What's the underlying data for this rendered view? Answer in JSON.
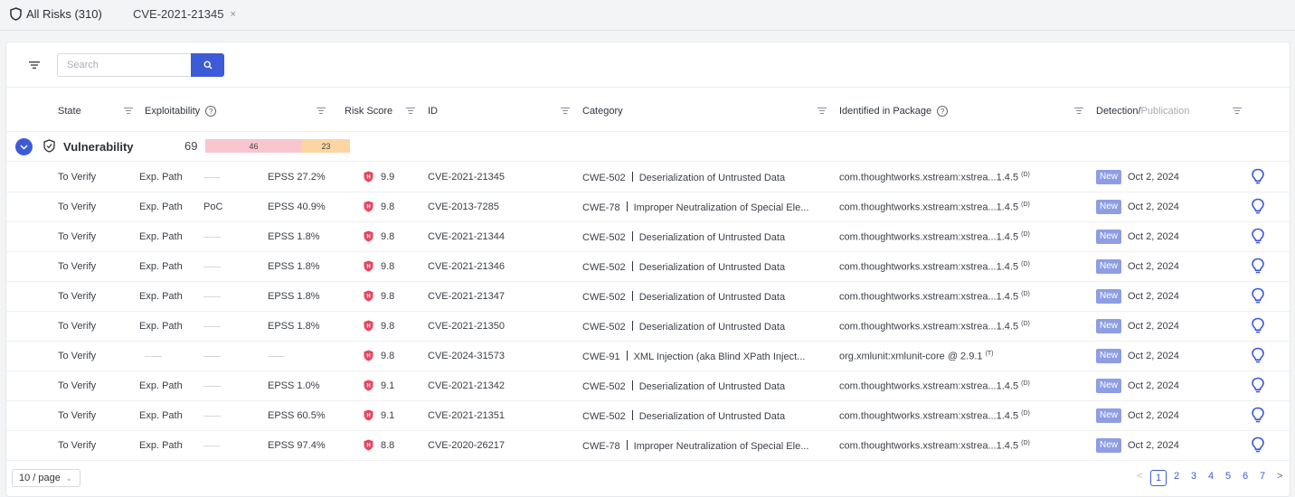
{
  "tabs": [
    {
      "label": "All Risks (310)",
      "icon": "shield-icon"
    },
    {
      "label": "CVE-2021-21345",
      "close": "×"
    }
  ],
  "search": {
    "placeholder": "Search"
  },
  "columns": {
    "state": "State",
    "exploitability": "Exploitability",
    "risk_score": "Risk Score",
    "id": "ID",
    "category": "Category",
    "package": "Identified in Package",
    "detection": "Detection",
    "detection_sep": "/",
    "publication": "Publication"
  },
  "group": {
    "label": "Vulnerability",
    "count": "69",
    "segments": [
      {
        "value": "46",
        "color": "#f8c6cf"
      },
      {
        "value": "23",
        "color": "#fbd6a3"
      }
    ]
  },
  "rows": [
    {
      "state": "To Verify",
      "exp": "Exp. Path",
      "poc": "",
      "epss": "EPSS 27.2%",
      "score": "9.9",
      "id": "CVE-2021-21345",
      "cwe": "CWE-502",
      "cat": "Deserialization of Untrusted Data",
      "pkg": "com.thoughtworks.xstream:xstrea...1.4.5",
      "pkg_tag": "(D)",
      "badge": "New",
      "date": "Oct 2, 2024"
    },
    {
      "state": "To Verify",
      "exp": "Exp. Path",
      "poc": "PoC",
      "epss": "EPSS 40.9%",
      "score": "9.8",
      "id": "CVE-2013-7285",
      "cwe": "CWE-78",
      "cat": "Improper Neutralization of Special Ele...",
      "pkg": "com.thoughtworks.xstream:xstrea...1.4.5",
      "pkg_tag": "(D)",
      "badge": "New",
      "date": "Oct 2, 2024"
    },
    {
      "state": "To Verify",
      "exp": "Exp. Path",
      "poc": "",
      "epss": "EPSS 1.8%",
      "score": "9.8",
      "id": "CVE-2021-21344",
      "cwe": "CWE-502",
      "cat": "Deserialization of Untrusted Data",
      "pkg": "com.thoughtworks.xstream:xstrea...1.4.5",
      "pkg_tag": "(D)",
      "badge": "New",
      "date": "Oct 2, 2024"
    },
    {
      "state": "To Verify",
      "exp": "Exp. Path",
      "poc": "",
      "epss": "EPSS 1.8%",
      "score": "9.8",
      "id": "CVE-2021-21346",
      "cwe": "CWE-502",
      "cat": "Deserialization of Untrusted Data",
      "pkg": "com.thoughtworks.xstream:xstrea...1.4.5",
      "pkg_tag": "(D)",
      "badge": "New",
      "date": "Oct 2, 2024"
    },
    {
      "state": "To Verify",
      "exp": "Exp. Path",
      "poc": "",
      "epss": "EPSS 1.8%",
      "score": "9.8",
      "id": "CVE-2021-21347",
      "cwe": "CWE-502",
      "cat": "Deserialization of Untrusted Data",
      "pkg": "com.thoughtworks.xstream:xstrea...1.4.5",
      "pkg_tag": "(D)",
      "badge": "New",
      "date": "Oct 2, 2024"
    },
    {
      "state": "To Verify",
      "exp": "Exp. Path",
      "poc": "",
      "epss": "EPSS 1.8%",
      "score": "9.8",
      "id": "CVE-2021-21350",
      "cwe": "CWE-502",
      "cat": "Deserialization of Untrusted Data",
      "pkg": "com.thoughtworks.xstream:xstrea...1.4.5",
      "pkg_tag": "(D)",
      "badge": "New",
      "date": "Oct 2, 2024"
    },
    {
      "state": "To Verify",
      "exp": "",
      "poc": "",
      "epss": "",
      "score": "9.8",
      "id": "CVE-2024-31573",
      "cwe": "CWE-91",
      "cat": "XML Injection (aka Blind XPath Inject...",
      "pkg": "org.xmlunit:xmlunit-core @ 2.9.1",
      "pkg_tag": "(T)",
      "badge": "New",
      "date": "Oct 2, 2024"
    },
    {
      "state": "To Verify",
      "exp": "Exp. Path",
      "poc": "",
      "epss": "EPSS 1.0%",
      "score": "9.1",
      "id": "CVE-2021-21342",
      "cwe": "CWE-502",
      "cat": "Deserialization of Untrusted Data",
      "pkg": "com.thoughtworks.xstream:xstrea...1.4.5",
      "pkg_tag": "(D)",
      "badge": "New",
      "date": "Oct 2, 2024"
    },
    {
      "state": "To Verify",
      "exp": "Exp. Path",
      "poc": "",
      "epss": "EPSS 60.5%",
      "score": "9.1",
      "id": "CVE-2021-21351",
      "cwe": "CWE-502",
      "cat": "Deserialization of Untrusted Data",
      "pkg": "com.thoughtworks.xstream:xstrea...1.4.5",
      "pkg_tag": "(D)",
      "badge": "New",
      "date": "Oct 2, 2024"
    },
    {
      "state": "To Verify",
      "exp": "Exp. Path",
      "poc": "",
      "epss": "EPSS 97.4%",
      "score": "8.8",
      "id": "CVE-2020-26217",
      "cwe": "CWE-78",
      "cat": "Improper Neutralization of Special Ele...",
      "pkg": "com.thoughtworks.xstream:xstrea...1.4.5",
      "pkg_tag": "(D)",
      "badge": "New",
      "date": "Oct 2, 2024"
    }
  ],
  "pagination": {
    "page_size": "10 / page",
    "pages": [
      "1",
      "2",
      "3",
      "4",
      "5",
      "6",
      "7"
    ],
    "current": "1",
    "prev": "<",
    "next": ">"
  },
  "colors": {
    "accent": "#3d5bd6",
    "score": "#e8455f",
    "badge": "#8d9ee4"
  }
}
